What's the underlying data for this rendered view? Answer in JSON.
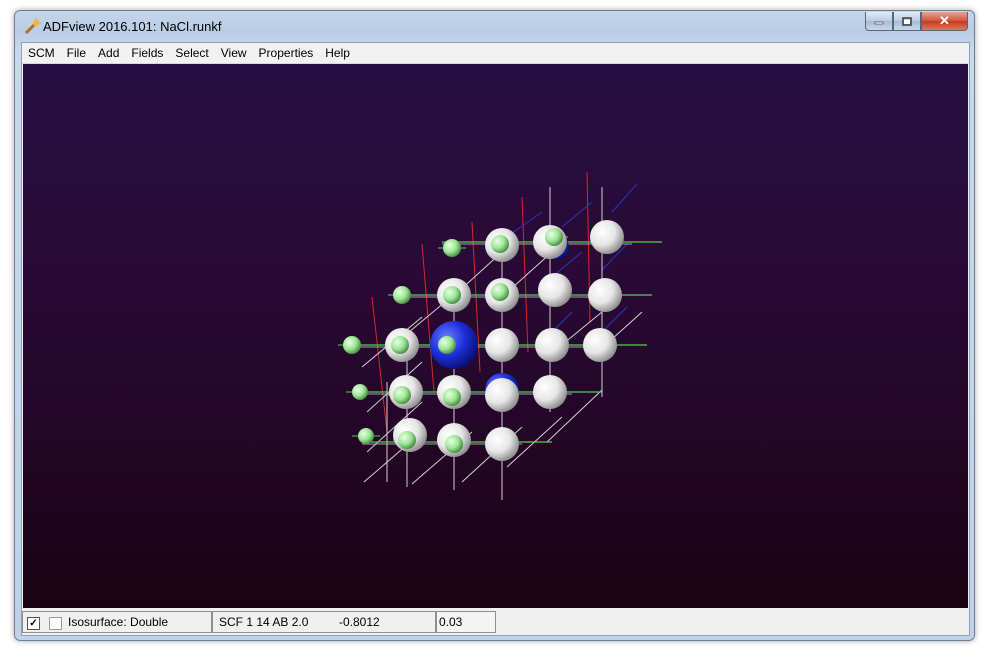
{
  "window": {
    "title": "ADFview 2016.101: NaCl.runkf",
    "app_icon": "adfview-wand-icon",
    "buttons": [
      "minimize-icon",
      "restore-icon",
      "close-icon"
    ],
    "close_glyph": "✕"
  },
  "menu": {
    "items": [
      "SCM",
      "File",
      "Add",
      "Fields",
      "Select",
      "View",
      "Properties",
      "Help"
    ]
  },
  "viewport": {
    "background_top": "#250e41",
    "background_bottom": "#1c0211",
    "atom_colors": {
      "Na_white": "#f4f4f4",
      "Cl_green": "#a8f0a0",
      "isosurface": "#1a2ed8"
    },
    "bond_colors": {
      "grid": "#d0d0d0",
      "green": "#4fd04f",
      "red": "#d22a2a",
      "blue": "#2a34c8"
    }
  },
  "statusbar": {
    "check1_glyph": "✓",
    "isosurface_label": "Isosurface: Double",
    "field_name": "SCF 1 14 AB 2.0",
    "field_value": "-0.8012",
    "iso_value": "0.03"
  }
}
